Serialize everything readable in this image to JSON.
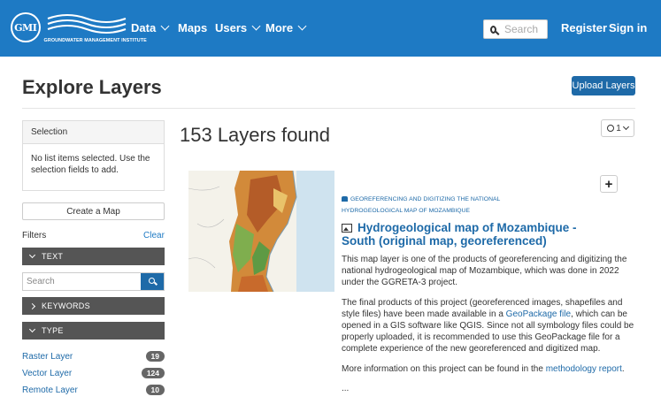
{
  "nav": {
    "logo_initials": "GMI",
    "logo_text": "GROUNDWATER MANAGEMENT INSTITUTE",
    "items": [
      {
        "label": "Data",
        "has_dropdown": true
      },
      {
        "label": "Maps",
        "has_dropdown": false
      },
      {
        "label": "Users",
        "has_dropdown": true
      },
      {
        "label": "More",
        "has_dropdown": true
      }
    ],
    "search_placeholder": "Search",
    "register": "Register",
    "signin": "Sign in",
    "bg_color": "#1e7ac4"
  },
  "header": {
    "title": "Explore Layers",
    "upload_button": "Upload Layers"
  },
  "sidebar": {
    "selection_title": "Selection",
    "selection_text": "No list items selected. Use the selection fields to add.",
    "create_map": "Create a Map",
    "filters_label": "Filters",
    "clear_label": "Clear",
    "facets": {
      "text": "TEXT",
      "keywords": "KEYWORDS",
      "type": "TYPE"
    },
    "text_search_placeholder": "Search",
    "types": [
      {
        "label": "Raster Layer",
        "count": "19"
      },
      {
        "label": "Vector Layer",
        "count": "124"
      },
      {
        "label": "Remote Layer",
        "count": "10"
      }
    ]
  },
  "results": {
    "count_text": "153 Layers found",
    "sort_label": "1",
    "item": {
      "group_line1": "GEOREFERENCING AND DIGITIZING THE NATIONAL",
      "group_line2": "HYDROGEOLOGICAL MAP OF MOZAMBIQUE",
      "title": "Hydrogeological map of Mozambique - South (original map, georeferenced)",
      "desc1": "This map layer is one of the products of georeferencing and digitizing the national hydrogeological map of Mozambique, which was done in 2022 under the GGRETA-3 project.",
      "desc2_before": "The final products of this project (georeferenced images, shapefiles and style files) have been made available in a ",
      "desc2_link": "GeoPackage file",
      "desc2_after": ", which can be opened in a GIS software like QGIS. Since not all symbology files could be properly uploaded, it is recommended to use this GeoPackage file for a complete experience of the new georeferenced and digitized map.",
      "desc3_before": "More information on this project can be found in the ",
      "desc3_link": "methodology report",
      "desc3_after": ".",
      "ellipsis": "..."
    }
  }
}
